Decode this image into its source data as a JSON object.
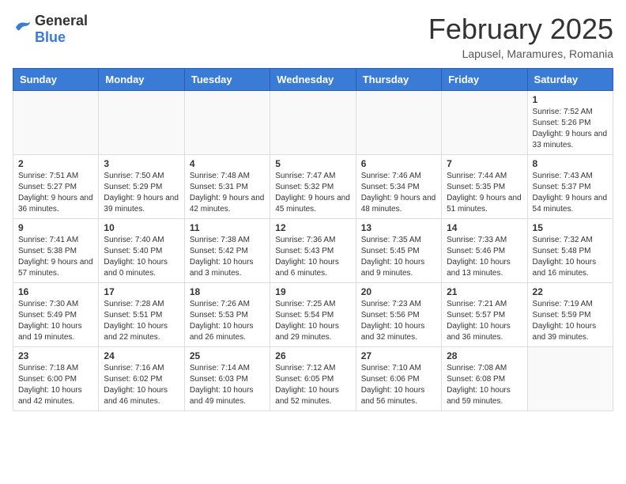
{
  "header": {
    "logo_general": "General",
    "logo_blue": "Blue",
    "month_title": "February 2025",
    "location": "Lapusel, Maramures, Romania"
  },
  "weekdays": [
    "Sunday",
    "Monday",
    "Tuesday",
    "Wednesday",
    "Thursday",
    "Friday",
    "Saturday"
  ],
  "weeks": [
    [
      {
        "day": "",
        "info": ""
      },
      {
        "day": "",
        "info": ""
      },
      {
        "day": "",
        "info": ""
      },
      {
        "day": "",
        "info": ""
      },
      {
        "day": "",
        "info": ""
      },
      {
        "day": "",
        "info": ""
      },
      {
        "day": "1",
        "info": "Sunrise: 7:52 AM\nSunset: 5:26 PM\nDaylight: 9 hours and 33 minutes."
      }
    ],
    [
      {
        "day": "2",
        "info": "Sunrise: 7:51 AM\nSunset: 5:27 PM\nDaylight: 9 hours and 36 minutes."
      },
      {
        "day": "3",
        "info": "Sunrise: 7:50 AM\nSunset: 5:29 PM\nDaylight: 9 hours and 39 minutes."
      },
      {
        "day": "4",
        "info": "Sunrise: 7:48 AM\nSunset: 5:31 PM\nDaylight: 9 hours and 42 minutes."
      },
      {
        "day": "5",
        "info": "Sunrise: 7:47 AM\nSunset: 5:32 PM\nDaylight: 9 hours and 45 minutes."
      },
      {
        "day": "6",
        "info": "Sunrise: 7:46 AM\nSunset: 5:34 PM\nDaylight: 9 hours and 48 minutes."
      },
      {
        "day": "7",
        "info": "Sunrise: 7:44 AM\nSunset: 5:35 PM\nDaylight: 9 hours and 51 minutes."
      },
      {
        "day": "8",
        "info": "Sunrise: 7:43 AM\nSunset: 5:37 PM\nDaylight: 9 hours and 54 minutes."
      }
    ],
    [
      {
        "day": "9",
        "info": "Sunrise: 7:41 AM\nSunset: 5:38 PM\nDaylight: 9 hours and 57 minutes."
      },
      {
        "day": "10",
        "info": "Sunrise: 7:40 AM\nSunset: 5:40 PM\nDaylight: 10 hours and 0 minutes."
      },
      {
        "day": "11",
        "info": "Sunrise: 7:38 AM\nSunset: 5:42 PM\nDaylight: 10 hours and 3 minutes."
      },
      {
        "day": "12",
        "info": "Sunrise: 7:36 AM\nSunset: 5:43 PM\nDaylight: 10 hours and 6 minutes."
      },
      {
        "day": "13",
        "info": "Sunrise: 7:35 AM\nSunset: 5:45 PM\nDaylight: 10 hours and 9 minutes."
      },
      {
        "day": "14",
        "info": "Sunrise: 7:33 AM\nSunset: 5:46 PM\nDaylight: 10 hours and 13 minutes."
      },
      {
        "day": "15",
        "info": "Sunrise: 7:32 AM\nSunset: 5:48 PM\nDaylight: 10 hours and 16 minutes."
      }
    ],
    [
      {
        "day": "16",
        "info": "Sunrise: 7:30 AM\nSunset: 5:49 PM\nDaylight: 10 hours and 19 minutes."
      },
      {
        "day": "17",
        "info": "Sunrise: 7:28 AM\nSunset: 5:51 PM\nDaylight: 10 hours and 22 minutes."
      },
      {
        "day": "18",
        "info": "Sunrise: 7:26 AM\nSunset: 5:53 PM\nDaylight: 10 hours and 26 minutes."
      },
      {
        "day": "19",
        "info": "Sunrise: 7:25 AM\nSunset: 5:54 PM\nDaylight: 10 hours and 29 minutes."
      },
      {
        "day": "20",
        "info": "Sunrise: 7:23 AM\nSunset: 5:56 PM\nDaylight: 10 hours and 32 minutes."
      },
      {
        "day": "21",
        "info": "Sunrise: 7:21 AM\nSunset: 5:57 PM\nDaylight: 10 hours and 36 minutes."
      },
      {
        "day": "22",
        "info": "Sunrise: 7:19 AM\nSunset: 5:59 PM\nDaylight: 10 hours and 39 minutes."
      }
    ],
    [
      {
        "day": "23",
        "info": "Sunrise: 7:18 AM\nSunset: 6:00 PM\nDaylight: 10 hours and 42 minutes."
      },
      {
        "day": "24",
        "info": "Sunrise: 7:16 AM\nSunset: 6:02 PM\nDaylight: 10 hours and 46 minutes."
      },
      {
        "day": "25",
        "info": "Sunrise: 7:14 AM\nSunset: 6:03 PM\nDaylight: 10 hours and 49 minutes."
      },
      {
        "day": "26",
        "info": "Sunrise: 7:12 AM\nSunset: 6:05 PM\nDaylight: 10 hours and 52 minutes."
      },
      {
        "day": "27",
        "info": "Sunrise: 7:10 AM\nSunset: 6:06 PM\nDaylight: 10 hours and 56 minutes."
      },
      {
        "day": "28",
        "info": "Sunrise: 7:08 AM\nSunset: 6:08 PM\nDaylight: 10 hours and 59 minutes."
      },
      {
        "day": "",
        "info": ""
      }
    ]
  ]
}
